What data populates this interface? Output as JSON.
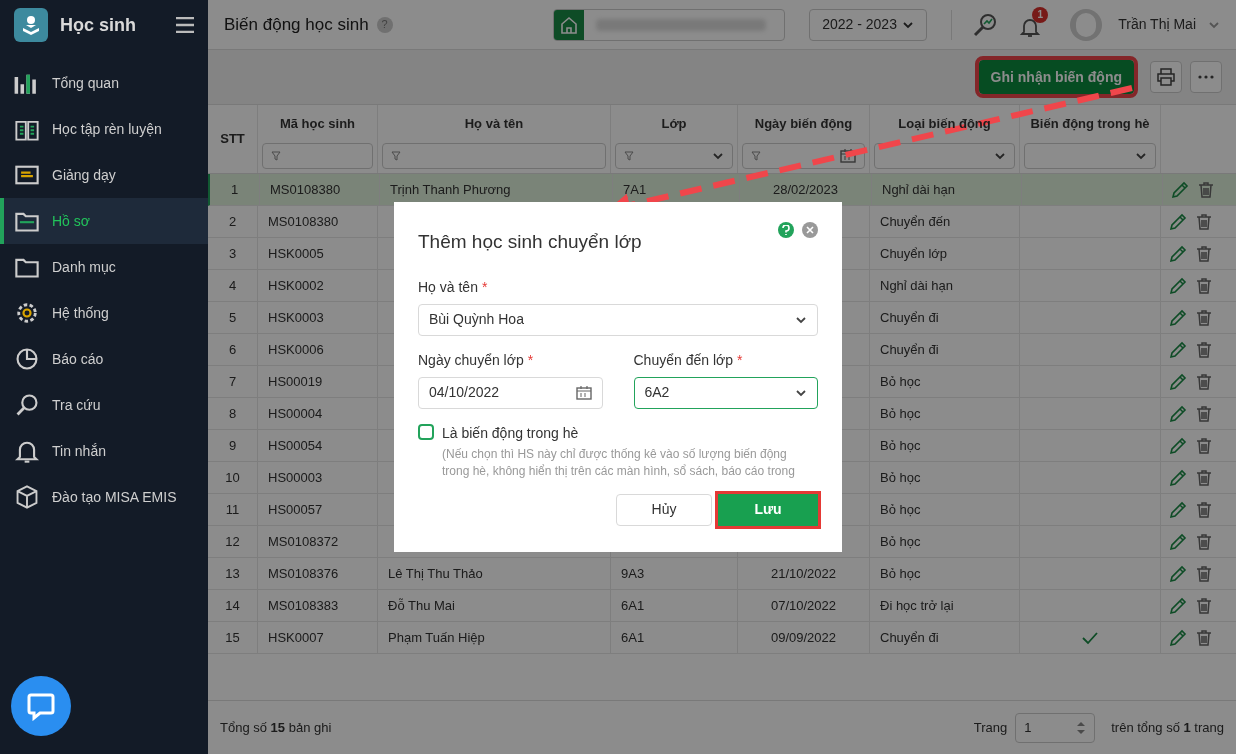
{
  "sidebar": {
    "app_title": "Học sinh",
    "items": [
      {
        "label": "Tổng quan",
        "selected": false
      },
      {
        "label": "Học tập rèn luyện",
        "selected": false
      },
      {
        "label": "Giảng dạy",
        "selected": false
      },
      {
        "label": "Hồ sơ",
        "selected": true
      },
      {
        "label": "Danh mục",
        "selected": false
      },
      {
        "label": "Hệ thống",
        "selected": false
      },
      {
        "label": "Báo cáo",
        "selected": false
      },
      {
        "label": "Tra cứu",
        "selected": false
      },
      {
        "label": "Tin nhắn",
        "selected": false
      },
      {
        "label": "Đào tạo MISA EMIS",
        "selected": false
      }
    ]
  },
  "header": {
    "title": "Biến động học sinh",
    "help": "?",
    "school_year": "2022 - 2023",
    "notification_count": "1",
    "user_name": "Trần Thị Mai"
  },
  "toolbar": {
    "primary_button": "Ghi nhận biến động"
  },
  "table": {
    "columns": [
      {
        "label": "STT",
        "kind": "plain"
      },
      {
        "label": "Mã học sinh",
        "kind": "text"
      },
      {
        "label": "Họ và tên",
        "kind": "text"
      },
      {
        "label": "Lớp",
        "kind": "combo"
      },
      {
        "label": "Ngày biến động",
        "kind": "date"
      },
      {
        "label": "Loại biến động",
        "kind": "select"
      },
      {
        "label": "Biến động trong hè",
        "kind": "select"
      }
    ],
    "rows": [
      {
        "stt": "1",
        "code": "MS0108380",
        "name": "Trịnh Thanh Phương",
        "class": "7A1",
        "date": "28/02/2023",
        "type": "Nghỉ dài hạn",
        "summer": false,
        "selected": true
      },
      {
        "stt": "2",
        "code": "MS0108380",
        "type": "Chuyển đến",
        "summer": false,
        "selected": false
      },
      {
        "stt": "3",
        "code": "HSK0005",
        "type": "Chuyển lớp",
        "summer": false,
        "selected": false
      },
      {
        "stt": "4",
        "code": "HSK0002",
        "type": "Nghỉ dài hạn",
        "summer": false,
        "selected": false
      },
      {
        "stt": "5",
        "code": "HSK0003",
        "type": "Chuyển đi",
        "summer": false,
        "selected": false
      },
      {
        "stt": "6",
        "code": "HSK0006",
        "type": "Chuyển đi",
        "summer": false,
        "selected": false
      },
      {
        "stt": "7",
        "code": "HS00019",
        "type": "Bỏ học",
        "summer": false,
        "selected": false
      },
      {
        "stt": "8",
        "code": "HS00004",
        "type": "Bỏ học",
        "summer": false,
        "selected": false
      },
      {
        "stt": "9",
        "code": "HS00054",
        "type": "Bỏ học",
        "summer": false,
        "selected": false
      },
      {
        "stt": "10",
        "code": "HS00003",
        "type": "Bỏ học",
        "summer": false,
        "selected": false
      },
      {
        "stt": "11",
        "code": "HS00057",
        "type": "Bỏ học",
        "summer": false,
        "selected": false
      },
      {
        "stt": "12",
        "code": "MS0108372",
        "type": "Bỏ học",
        "summer": false,
        "selected": false
      },
      {
        "stt": "13",
        "code": "MS0108376",
        "name": "Lê Thị Thu Thảo",
        "class": "9A3",
        "date": "21/10/2022",
        "type": "Bỏ học",
        "summer": false,
        "selected": false
      },
      {
        "stt": "14",
        "code": "MS0108383",
        "name": "Đỗ Thu Mai",
        "class": "6A1",
        "date": "07/10/2022",
        "type": "Đi học trở lại",
        "summer": false,
        "selected": false
      },
      {
        "stt": "15",
        "code": "HSK0007",
        "name": "Phạm Tuấn Hiệp",
        "class": "6A1",
        "date": "09/09/2022",
        "type": "Chuyển đi",
        "summer": true,
        "selected": false
      }
    ]
  },
  "footer": {
    "total": "Tổng số **15** bản ghi",
    "page_label": "Trang",
    "page": "1",
    "page_total": "trên tổng số **1** trang"
  },
  "modal": {
    "title": "Thêm học sinh chuyển lớp",
    "student": {
      "label": "Họ và tên",
      "required_mark": "*",
      "value": "Bùi Quỳnh Hoa"
    },
    "date": {
      "label": "Ngày chuyển lớp",
      "required_mark": "*",
      "value": "04/10/2022"
    },
    "target_class": {
      "label": "Chuyển đến lớp",
      "required_mark": "*",
      "value": "6A2",
      "focused": true
    },
    "summer": {
      "label": "Là biến động trong hè",
      "checked": false,
      "note": "(Nếu chọn thì HS này chỉ được thống kê vào số lượng biến động trong hè, không hiển thị trên các màn hình, sổ sách, báo cáo trong"
    },
    "cancel": "Hủy",
    "save": "Lưu"
  }
}
